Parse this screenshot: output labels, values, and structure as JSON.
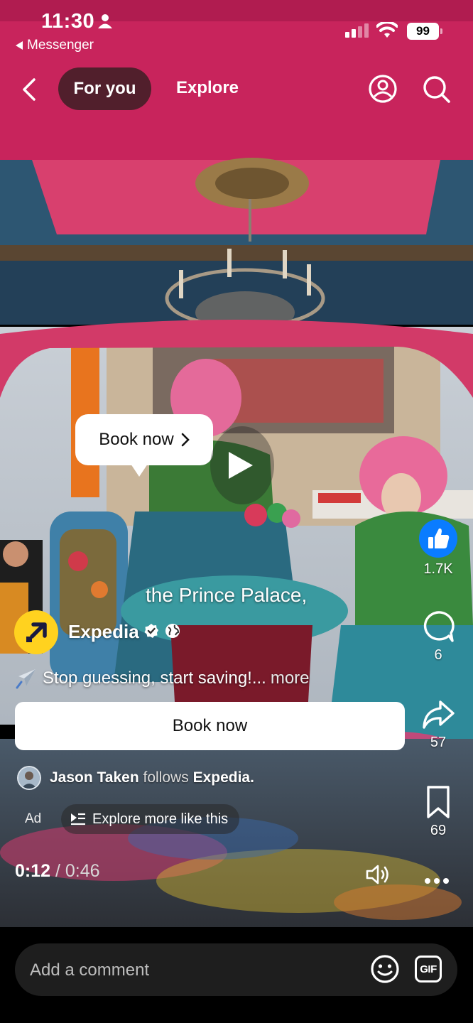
{
  "status_bar": {
    "time": "11:30",
    "back_app": "Messenger",
    "battery": "99"
  },
  "nav": {
    "tabs": [
      {
        "label": "For you",
        "active": true
      },
      {
        "label": "Explore",
        "active": false
      }
    ],
    "icons": [
      "chevron-left-icon",
      "profile-icon",
      "search-icon"
    ]
  },
  "video": {
    "book_bubble_label": "Book now",
    "caption": "the Prince Palace,",
    "elapsed": "0:12",
    "separator": "/",
    "duration": "0:46"
  },
  "ad": {
    "brand": "Expedia",
    "text": "Stop guessing, start saving!...",
    "more_label": "more",
    "cta_label": "Book now",
    "follower_name": "Jason Taken",
    "follows_word": "follows",
    "follows_target": "Expedia.",
    "ad_label": "Ad",
    "explore_more_label": "Explore more like this"
  },
  "actions": {
    "likes": "1.7K",
    "comments": "6",
    "shares": "57",
    "saves": "69"
  },
  "comment_bar": {
    "placeholder": "Add a comment",
    "gif_label": "GIF"
  },
  "colors": {
    "like_blue": "#0a7cff",
    "expedia_yellow": "#ffd21f",
    "canopy_pink": "#c8245c",
    "comment_box_bg": "#1e1e1e"
  }
}
